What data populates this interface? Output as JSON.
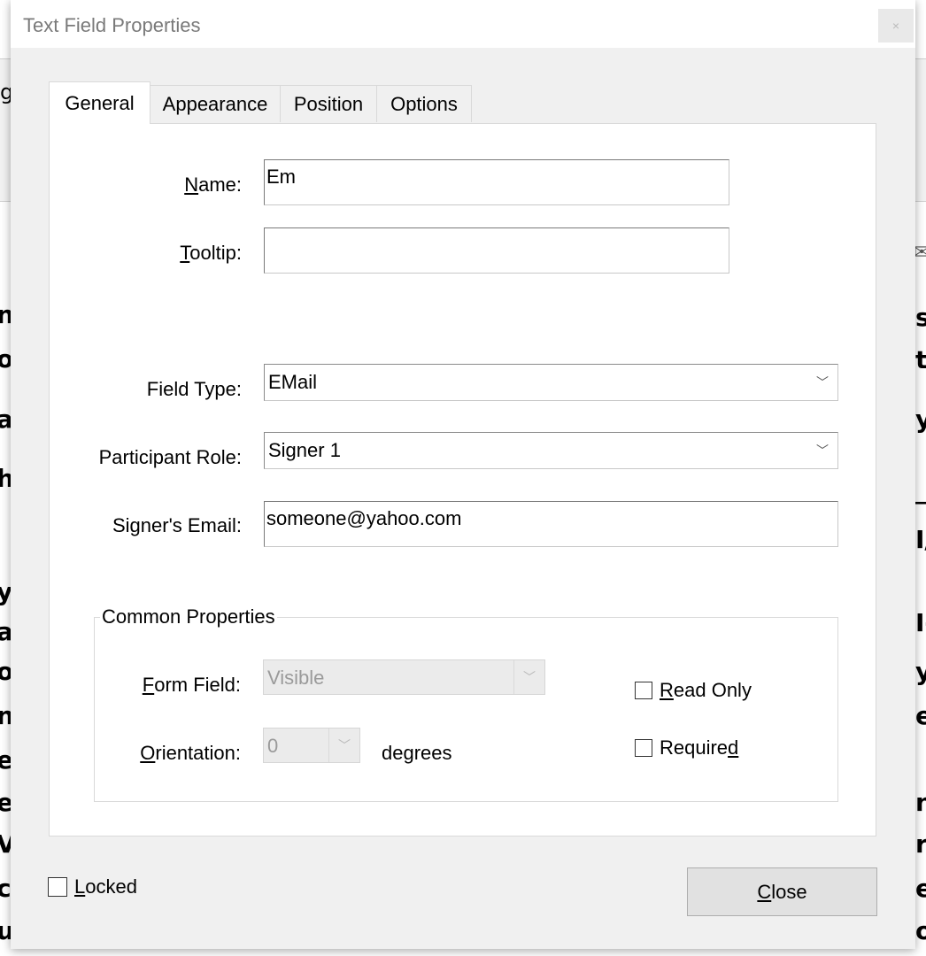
{
  "dialog": {
    "title": "Text Field Properties",
    "close_glyph": "×"
  },
  "tabs": [
    {
      "label": "General",
      "active": true
    },
    {
      "label": "Appearance",
      "active": false
    },
    {
      "label": "Position",
      "active": false
    },
    {
      "label": "Options",
      "active": false
    }
  ],
  "general": {
    "name": {
      "label_mnemonic": "N",
      "label_rest": "ame:",
      "value": "Em"
    },
    "tooltip": {
      "label_mnemonic": "T",
      "label_rest": "ooltip:",
      "value": ""
    },
    "field_type": {
      "label": "Field Type:",
      "value": "EMail"
    },
    "participant_role": {
      "label": "Participant Role:",
      "value": "Signer 1"
    },
    "signers_email": {
      "label": "Signer's Email:",
      "value": "someone@yahoo.com"
    }
  },
  "common_properties": {
    "title": "Common Properties",
    "form_field": {
      "label_mnemonic": "F",
      "label_rest": "orm Field:",
      "value": "Visible"
    },
    "orientation": {
      "label_mnemonic": "O",
      "label_rest": "rientation:",
      "value": "0",
      "unit": "degrees"
    },
    "read_only": {
      "label_mnemonic": "R",
      "label_rest": "ead Only",
      "checked": false
    },
    "required": {
      "label_prefix": "Require",
      "label_mnemonic": "d",
      "checked": false
    }
  },
  "footer": {
    "locked": {
      "label_mnemonic": "L",
      "label_rest": "ocked",
      "checked": false
    },
    "close_button": {
      "label_mnemonic": "C",
      "label_rest": "lose"
    }
  },
  "background": {
    "left_fragments": [
      "n",
      "o",
      "a",
      "h",
      "y",
      "a",
      "o",
      "n",
      "e",
      "e",
      "V",
      "c",
      "u"
    ],
    "right_fragments": [
      "s",
      "ta",
      "y",
      "_",
      "I/",
      "I-",
      "y",
      "e",
      "n",
      "r",
      "e",
      "o"
    ],
    "left_top_text": "g"
  },
  "colors": {
    "dialog_bg": "#f0f0f0",
    "panel_bg": "#ffffff",
    "title_text": "#7a7a7a",
    "button_bg": "#e1e1e1"
  }
}
